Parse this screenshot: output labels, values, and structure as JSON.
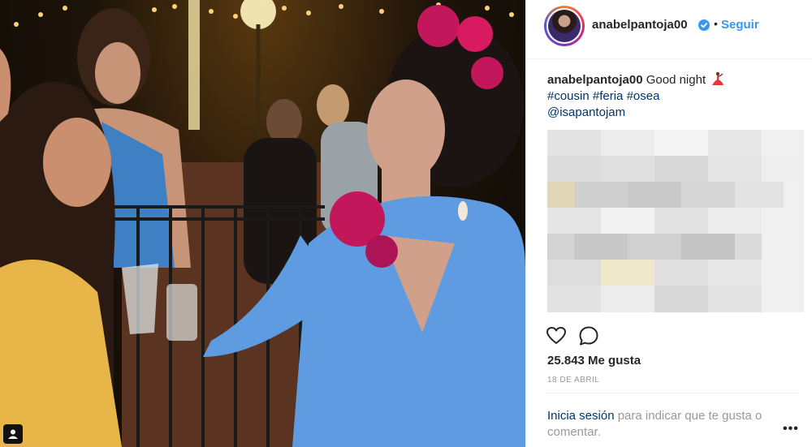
{
  "post": {
    "username": "anabelpantoja00",
    "follow_label": "Seguir",
    "separator": "•",
    "caption": {
      "text": "Good night",
      "hashtags": [
        "#cousin",
        "#feria",
        "#osea"
      ],
      "mention": "@isapantojam"
    },
    "likes_text": "25.843 Me gusta",
    "date_text": "18 DE ABRIL",
    "login": {
      "link_label": "Inicia sesión",
      "rest_text": " para indicar que te gusta o comentar."
    },
    "more_label": "•••"
  },
  "icons": {
    "verified": "verified-badge-icon",
    "like": "heart-icon",
    "comment": "comment-icon",
    "photo_badge": "user-tag-icon",
    "dancer": "flamenco-dancer-emoji"
  },
  "colors": {
    "link_blue": "#3897f0",
    "hashtag_blue": "#003569",
    "muted": "#999999",
    "text": "#262626"
  }
}
